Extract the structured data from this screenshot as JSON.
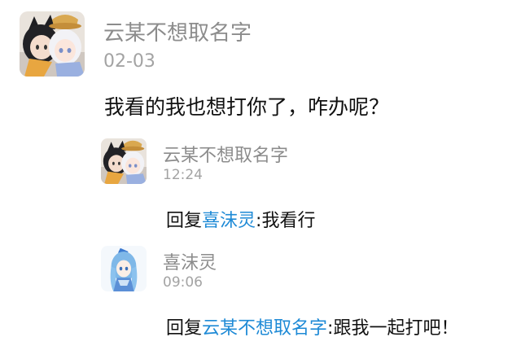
{
  "comment": {
    "author": "云某不想取名字",
    "time": "02-03",
    "content": "我看的我也想打你了，咋办呢？",
    "avatar_icon": "anime-character-avatar-icon"
  },
  "replies": [
    {
      "author": "云某不想取名字",
      "time": "12:24",
      "prefix": "回复",
      "mention": "喜沫灵",
      "separator": ":",
      "text": "我看行",
      "avatar_icon": "anime-character-avatar-icon"
    },
    {
      "author": "喜沫灵",
      "time": "09:06",
      "prefix": "回复",
      "mention": "云某不想取名字",
      "separator": ":",
      "text": "跟我一起打吧！",
      "avatar_icon": "anime-girl-avatar-icon"
    }
  ],
  "colors": {
    "name": "#8c8c8c",
    "time": "#a3a3a3",
    "text": "#111111",
    "mention": "#1e8ad6"
  }
}
